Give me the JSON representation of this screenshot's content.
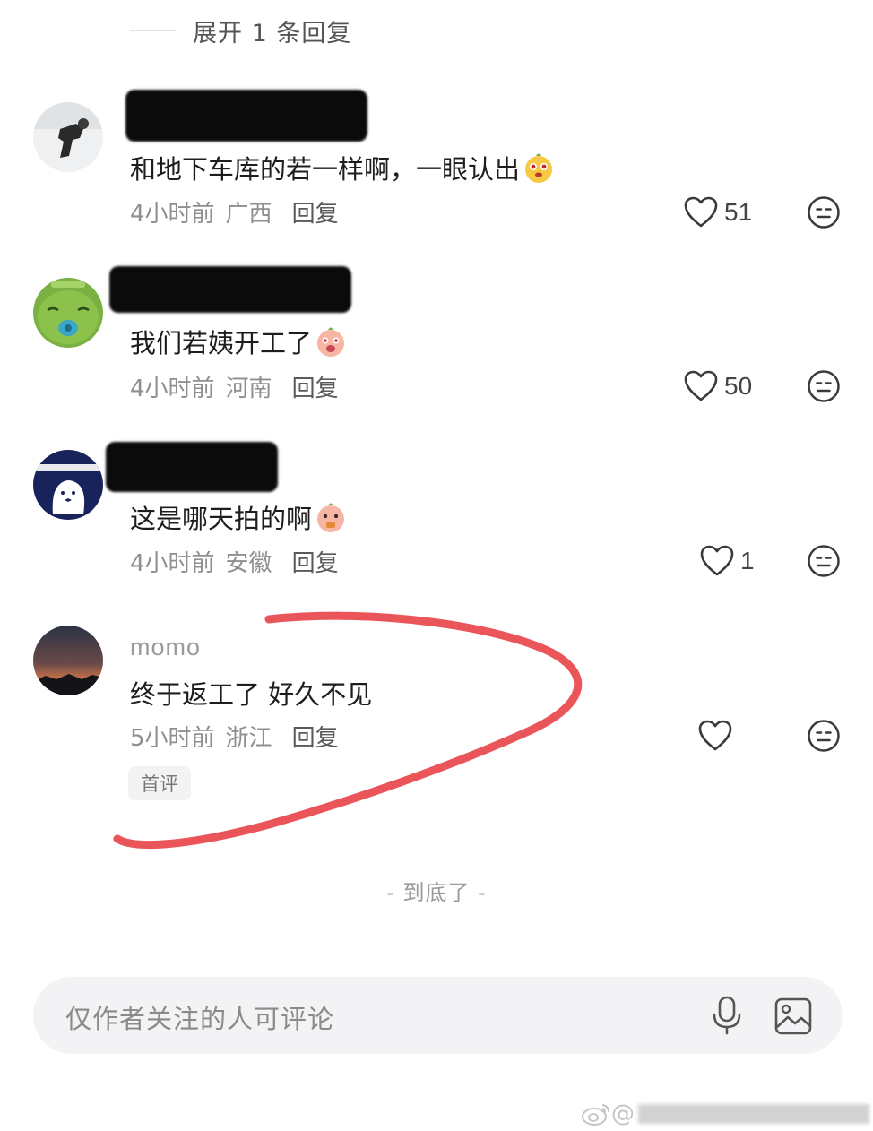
{
  "expand_replies": "展开 1 条回复",
  "comments": [
    {
      "content": "和地下车库的若一样啊，一眼认出",
      "time": "4小时前",
      "location": "广西",
      "reply": "回复",
      "likes": "51"
    },
    {
      "content": "我们若姨开工了",
      "time": "4小时前",
      "location": "河南",
      "reply": "回复",
      "likes": "50"
    },
    {
      "content": "这是哪天拍的啊",
      "time": "4小时前",
      "location": "安徽",
      "reply": "回复",
      "likes": "1"
    },
    {
      "username": "momo",
      "content": "终于返工了 好久不见",
      "time": "5小时前",
      "location": "浙江",
      "reply": "回复",
      "likes": "",
      "badge": "首评"
    }
  ],
  "bottom_hint": "- 到底了 -",
  "input": {
    "placeholder": "仅作者关注的人可评论"
  },
  "watermark": "@",
  "annotation_color": "#e8474c",
  "icons": [
    "heart-icon",
    "dislike-face-icon",
    "mic-icon",
    "image-icon",
    "weibo-logo-icon"
  ]
}
